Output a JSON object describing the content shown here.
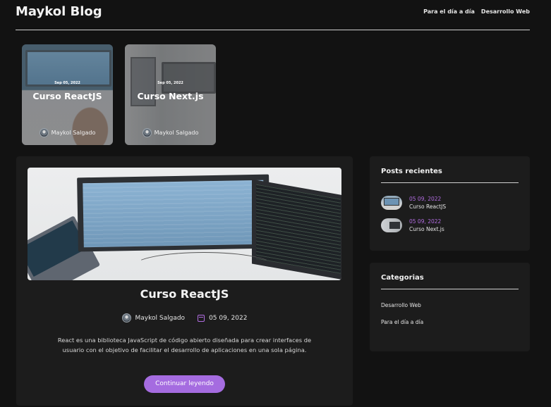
{
  "header": {
    "brand": "Maykol Blog",
    "nav": [
      "Para el día a día",
      "Desarrollo Web"
    ]
  },
  "featured": [
    {
      "date": "Sep 05, 2022",
      "title": "Curso ReactJS",
      "author": "Maykol Salgado"
    },
    {
      "date": "Sep 05, 2022",
      "title": "Curso Next.js",
      "author": "Maykol Salgado"
    }
  ],
  "post": {
    "title": "Curso ReactJS",
    "author": "Maykol Salgado",
    "date": "05 09, 2022",
    "excerpt": "React es una biblioteca JavaScript de código abierto diseñada para crear interfaces de usuario con el objetivo de facilitar el desarrollo de aplicaciones en una sola página.",
    "button": "Continuar leyendo"
  },
  "recent": {
    "heading": "Posts recientes",
    "items": [
      {
        "date": "05 09, 2022",
        "title": "Curso ReactJS"
      },
      {
        "date": "05 09, 2022",
        "title": "Curso Next.js"
      }
    ]
  },
  "categories": {
    "heading": "Categorias",
    "items": [
      "Desarrollo Web",
      "Para el día a día"
    ]
  },
  "colors": {
    "background": "#121212",
    "card": "#1c1c1c",
    "accent": "#a56ce0"
  },
  "icons": {
    "author": "avatar-icon",
    "date": "calendar-icon"
  }
}
